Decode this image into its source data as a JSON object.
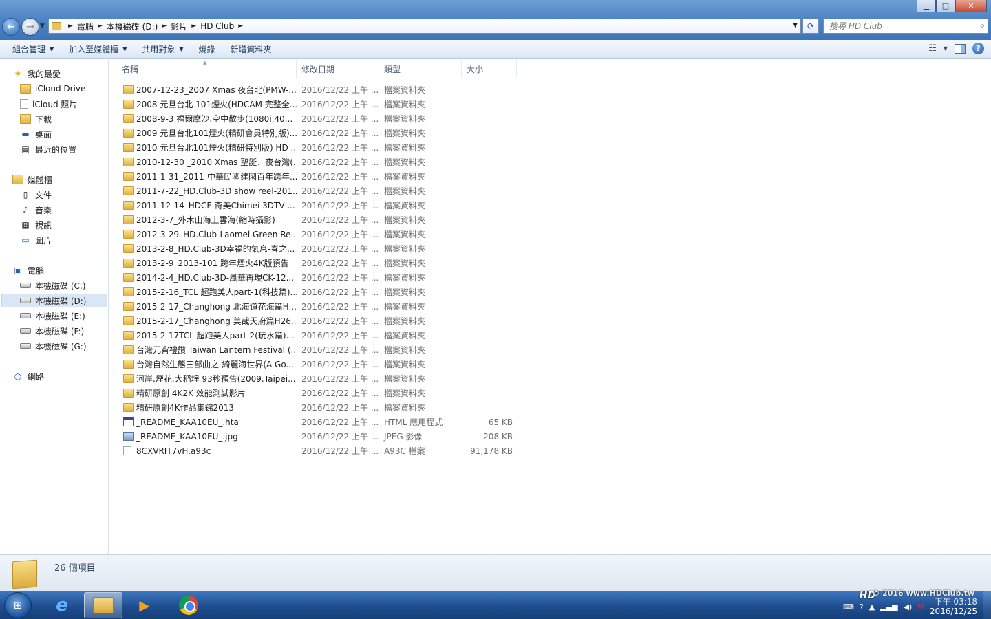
{
  "window": {
    "controls": {
      "minimize": "▁",
      "maximize": "□",
      "close": "✕"
    }
  },
  "addressbar": {
    "crumbs": [
      "電腦",
      "本機磁碟 (D:)",
      "影片",
      "HD Club"
    ],
    "search_placeholder": "搜尋 HD Club"
  },
  "toolbar": {
    "organize": "組合管理",
    "add_to_library": "加入至媒體櫃",
    "share_with": "共用對象",
    "burn": "燒錄",
    "new_folder": "新增資料夾"
  },
  "navpane": {
    "favorites": {
      "label": "我的最愛",
      "items": [
        "iCloud Drive",
        "iCloud 照片",
        "下載",
        "桌面",
        "最近的位置"
      ]
    },
    "libraries": {
      "label": "媒體櫃",
      "items": [
        "文件",
        "音樂",
        "視訊",
        "圖片"
      ]
    },
    "computer": {
      "label": "電腦",
      "items": [
        "本機磁碟 (C:)",
        "本機磁碟 (D:)",
        "本機磁碟 (E:)",
        "本機磁碟 (F:)",
        "本機磁碟 (G:)"
      ],
      "selected": "本機磁碟 (D:)"
    },
    "network": {
      "label": "網路"
    }
  },
  "columns": {
    "name": "名稱",
    "date": "修改日期",
    "type": "類型",
    "size": "大小"
  },
  "files": [
    {
      "name": "2007-12-23_2007 Xmas 夜台北(PMW-...",
      "date": "2016/12/22 上午 ...",
      "type": "檔案資料夾",
      "size": "",
      "icon": "folder"
    },
    {
      "name": "2008 元旦台北 101煙火(HDCAM 完整全...",
      "date": "2016/12/22 上午 ...",
      "type": "檔案資料夾",
      "size": "",
      "icon": "folder"
    },
    {
      "name": "2008-9-3 福爾摩沙.空中散步(1080i,40...",
      "date": "2016/12/22 上午 ...",
      "type": "檔案資料夾",
      "size": "",
      "icon": "folder"
    },
    {
      "name": "2009 元旦台北101煙火(精研會員特別版)...",
      "date": "2016/12/22 上午 ...",
      "type": "檔案資料夾",
      "size": "",
      "icon": "folder"
    },
    {
      "name": "2010 元旦台北101煙火(精研特別版) HD ...",
      "date": "2016/12/22 上午 ...",
      "type": "檔案資料夾",
      "size": "",
      "icon": "folder"
    },
    {
      "name": "2010-12-30 _2010 Xmas 聖誕．夜台灣(...",
      "date": "2016/12/22 上午 ...",
      "type": "檔案資料夾",
      "size": "",
      "icon": "folder"
    },
    {
      "name": "2011-1-31_2011-中華民國建國百年跨年...",
      "date": "2016/12/22 上午 ...",
      "type": "檔案資料夾",
      "size": "",
      "icon": "folder"
    },
    {
      "name": "2011-7-22_HD.Club-3D show reel-201...",
      "date": "2016/12/22 上午 ...",
      "type": "檔案資料夾",
      "size": "",
      "icon": "folder"
    },
    {
      "name": "2011-12-14_HDCF-奇美Chimei 3DTV-...",
      "date": "2016/12/22 上午 ...",
      "type": "檔案資料夾",
      "size": "",
      "icon": "folder"
    },
    {
      "name": "2012-3-7_外木山海上雲海(縮時攝影)",
      "date": "2016/12/22 上午 ...",
      "type": "檔案資料夾",
      "size": "",
      "icon": "folder"
    },
    {
      "name": "2012-3-29_HD.Club-Laomei Green Re...",
      "date": "2016/12/22 上午 ...",
      "type": "檔案資料夾",
      "size": "",
      "icon": "folder"
    },
    {
      "name": "2013-2-8_HD.Club-3D幸福的氣息-春之...",
      "date": "2016/12/22 上午 ...",
      "type": "檔案資料夾",
      "size": "",
      "icon": "folder"
    },
    {
      "name": "2013-2-9_2013-101 跨年煙火4K版預告",
      "date": "2016/12/22 上午 ...",
      "type": "檔案資料夾",
      "size": "",
      "icon": "folder"
    },
    {
      "name": "2014-2-4_HD.Club-3D-風華再現CK-12...",
      "date": "2016/12/22 上午 ...",
      "type": "檔案資料夾",
      "size": "",
      "icon": "folder"
    },
    {
      "name": "2015-2-16_TCL 超跑美人part-1(科技篇)...",
      "date": "2016/12/22 上午 ...",
      "type": "檔案資料夾",
      "size": "",
      "icon": "folder"
    },
    {
      "name": "2015-2-17_Changhong 北海道花海篇H...",
      "date": "2016/12/22 上午 ...",
      "type": "檔案資料夾",
      "size": "",
      "icon": "folder"
    },
    {
      "name": "2015-2-17_Changhong 美哉天府篇H26...",
      "date": "2016/12/22 上午 ...",
      "type": "檔案資料夾",
      "size": "",
      "icon": "folder"
    },
    {
      "name": "2015-2-17TCL 超跑美人part-2(玩水篇)...",
      "date": "2016/12/22 上午 ...",
      "type": "檔案資料夾",
      "size": "",
      "icon": "folder"
    },
    {
      "name": "台灣元宵禮讚 Taiwan Lantern Festival (...",
      "date": "2016/12/22 上午 ...",
      "type": "檔案資料夾",
      "size": "",
      "icon": "folder"
    },
    {
      "name": "台灣自然生態三部曲之-綺麗海世界(A Go...",
      "date": "2016/12/22 上午 ...",
      "type": "檔案資料夾",
      "size": "",
      "icon": "folder"
    },
    {
      "name": "河岸.煙花.大稻埕 93秒預告(2009.Taipei...",
      "date": "2016/12/22 上午 ...",
      "type": "檔案資料夾",
      "size": "",
      "icon": "folder"
    },
    {
      "name": "精研原創 4K2K 效能測試影片",
      "date": "2016/12/22 上午 ...",
      "type": "檔案資料夾",
      "size": "",
      "icon": "folder"
    },
    {
      "name": "精研原創4K作品集錦2013",
      "date": "2016/12/22 上午 ...",
      "type": "檔案資料夾",
      "size": "",
      "icon": "folder"
    },
    {
      "name": "_README_KAA10EU_.hta",
      "date": "2016/12/22 上午 ...",
      "type": "HTML 應用程式",
      "size": "65 KB",
      "icon": "hta"
    },
    {
      "name": "_README_KAA10EU_.jpg",
      "date": "2016/12/22 上午 ...",
      "type": "JPEG 影像",
      "size": "208 KB",
      "icon": "jpg"
    },
    {
      "name": "8CXVRIT7vH.a93c",
      "date": "2016/12/22 上午 ...",
      "type": "A93C 檔案",
      "size": "91,178 KB",
      "icon": "doc"
    }
  ],
  "details": {
    "item_count": "26 個項目"
  },
  "taskbar": {
    "apps": [
      "internet-explorer",
      "windows-explorer",
      "media-player",
      "chrome"
    ],
    "watermark": "© 2016 www.HDClub.tw",
    "watermark_logo": "HD",
    "time": "下午 03:18",
    "date": "2016/12/25"
  }
}
